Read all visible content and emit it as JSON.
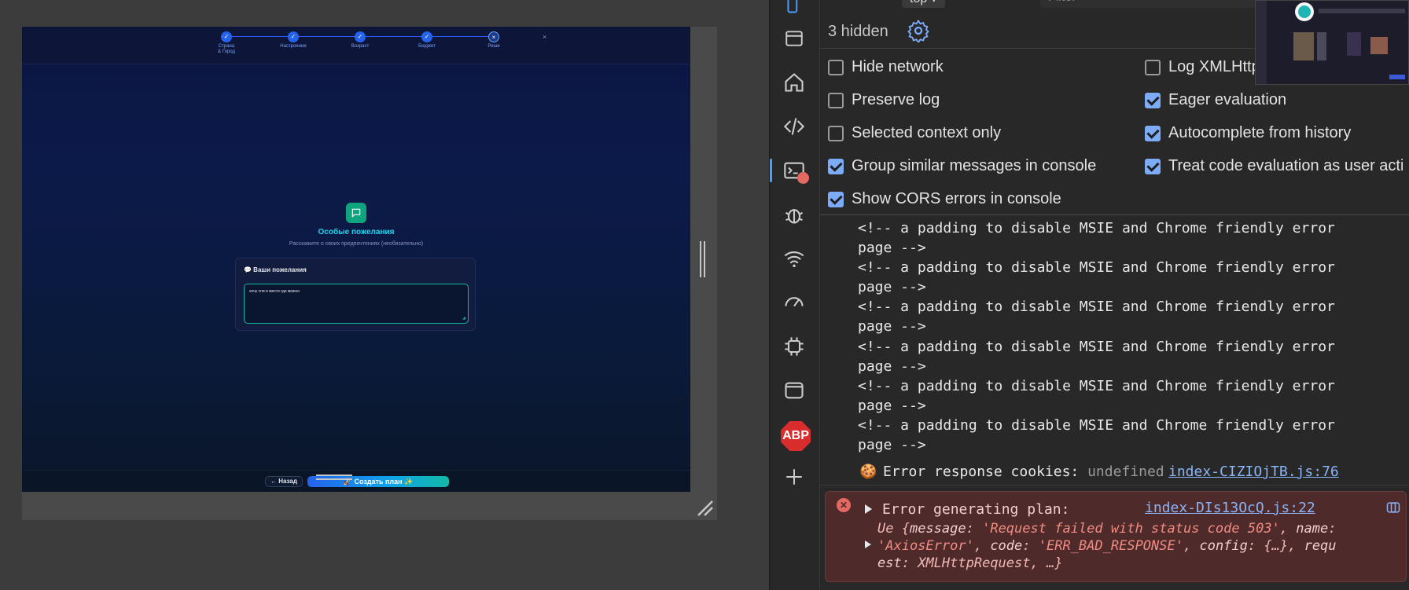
{
  "device": {
    "steps": [
      {
        "label": "Страна & Город",
        "label_line1": "Страна",
        "label_line2": "& Город",
        "state": "done"
      },
      {
        "label": "Настроение",
        "state": "done"
      },
      {
        "label": "Возраст",
        "state": "done"
      },
      {
        "label": "Бюджет",
        "state": "done"
      },
      {
        "label": "Реши",
        "state": "active"
      }
    ],
    "close_glyph": "×",
    "section_title": "Особые пожелания",
    "section_subtitle": "Расскажите о своих предпочтениях (необязательно)",
    "wish_card_title": "💬 Ваши пожелания",
    "wish_text": "хочу спи и место где можно",
    "back_button": "← Назад",
    "create_button": "🚀 Создать план ✨"
  },
  "devtools": {
    "toolbar": {
      "context": "top ▾",
      "filter_placeholder": "Filter"
    },
    "hidden_count": "3 hidden",
    "settings": [
      {
        "label": "Hide network",
        "checked": false
      },
      {
        "label": "Log XMLHttpRequests",
        "checked": false
      },
      {
        "label": "Preserve log",
        "checked": false
      },
      {
        "label": "Eager evaluation",
        "checked": true
      },
      {
        "label": "Selected context only",
        "checked": false
      },
      {
        "label": "Autocomplete from history",
        "checked": true
      },
      {
        "label": "Group similar messages in console",
        "checked": true
      },
      {
        "label": "Treat code evaluation as user action",
        "checked": true
      },
      {
        "label": "Show CORS errors in console",
        "checked": true
      }
    ],
    "log_lines": [
      "<!-- a padding to disable MSIE and Chrome friendly error",
      "page -->",
      "<!-- a padding to disable MSIE and Chrome friendly error",
      "page -->",
      "<!-- a padding to disable MSIE and Chrome friendly error",
      "page -->",
      "<!-- a padding to disable MSIE and Chrome friendly error",
      "page -->",
      "<!-- a padding to disable MSIE and Chrome friendly error",
      "page -->",
      "<!-- a padding to disable MSIE and Chrome friendly error",
      "page -->"
    ],
    "cookie": {
      "label": "Error response cookies:",
      "value": "undefined",
      "source": "index-CIZIOjTB.js:76"
    },
    "error": {
      "title": "Error generating plan:",
      "source": "index-DIs13OcQ.js:22",
      "line1_prefix": "Ue {",
      "line1_key1": "message",
      "line1_val1": "'Request failed with status code 503'",
      "line1_key2": "name",
      "line2_val": "'AxiosError'",
      "line2_key": "code",
      "line2_val2": "'ERR_BAD_RESPONSE'",
      "line2_key3": "config",
      "line2_rest": "{…}",
      "line2_key4": "requ",
      "line3_cont": "est",
      "line3_val": "XMLHttpRequest, …}"
    },
    "colors": {
      "accent": "#7cacf8",
      "error_bg": "#4e2a2a",
      "link": "#8ab4f8"
    }
  }
}
